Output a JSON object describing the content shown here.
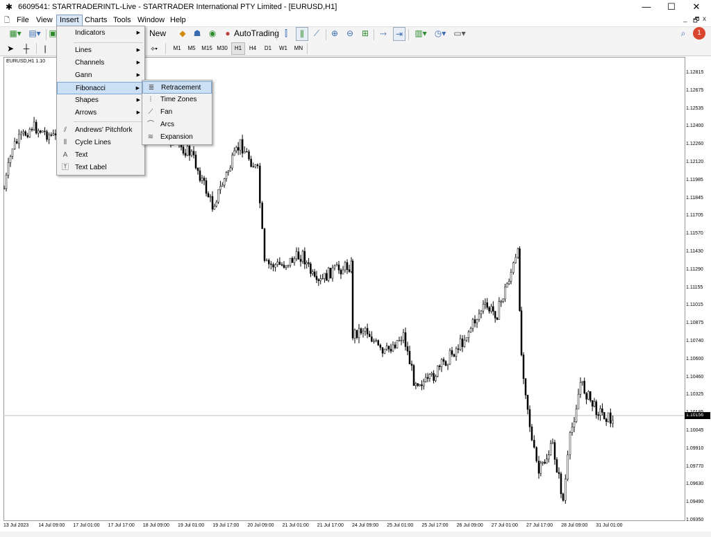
{
  "window": {
    "title": "6609541: STARTRADERINTL-Live - STARTRADER International PTY Limited - [EURUSD,H1]",
    "minimize": "—",
    "maximize": "☐",
    "close": "✕"
  },
  "menubar": {
    "items": [
      "File",
      "View",
      "Insert",
      "Charts",
      "Tools",
      "Window",
      "Help"
    ],
    "mdi": [
      "_",
      "🗗",
      "x"
    ]
  },
  "toolbar": {
    "new_order": "New Order",
    "autotrading": "AutoTrading",
    "timeframes": [
      "M1",
      "M5",
      "M15",
      "M30",
      "H1",
      "H4",
      "D1",
      "W1",
      "MN"
    ],
    "selected_timeframe": "H1"
  },
  "chart": {
    "symbol_label": "EURUSD,H1  1.10",
    "current_price": "1.10156",
    "price_labels": [
      "1.12815",
      "1.12675",
      "1.12535",
      "1.12400",
      "1.12260",
      "1.12120",
      "1.11985",
      "1.11845",
      "1.11705",
      "1.11570",
      "1.11430",
      "1.11290",
      "1.11155",
      "1.11015",
      "1.10875",
      "1.10740",
      "1.10600",
      "1.10460",
      "1.10325",
      "1.10185",
      "1.10045",
      "1.09910",
      "1.09770",
      "1.09630",
      "1.09490",
      "1.09350"
    ],
    "time_labels": [
      "13 Jul 2023",
      "14 Jul 09:00",
      "17 Jul 01:00",
      "17 Jul 17:00",
      "18 Jul 09:00",
      "19 Jul 01:00",
      "19 Jul 17:00",
      "20 Jul 09:00",
      "21 Jul 01:00",
      "21 Jul 17:00",
      "24 Jul 09:00",
      "25 Jul 01:00",
      "25 Jul 17:00",
      "26 Jul 09:00",
      "27 Jul 01:00",
      "27 Jul 17:00",
      "28 Jul 09:00",
      "31 Jul 01:00"
    ]
  },
  "insert_menu": {
    "items": [
      "Indicators",
      "Lines",
      "Channels",
      "Gann",
      "Fibonacci",
      "Shapes",
      "Arrows",
      "Andrews' Pitchfork",
      "Cycle Lines",
      "Text",
      "Text Label"
    ]
  },
  "fibonacci_submenu": {
    "items": [
      "Retracement",
      "Time Zones",
      "Fan",
      "Arcs",
      "Expansion"
    ]
  }
}
